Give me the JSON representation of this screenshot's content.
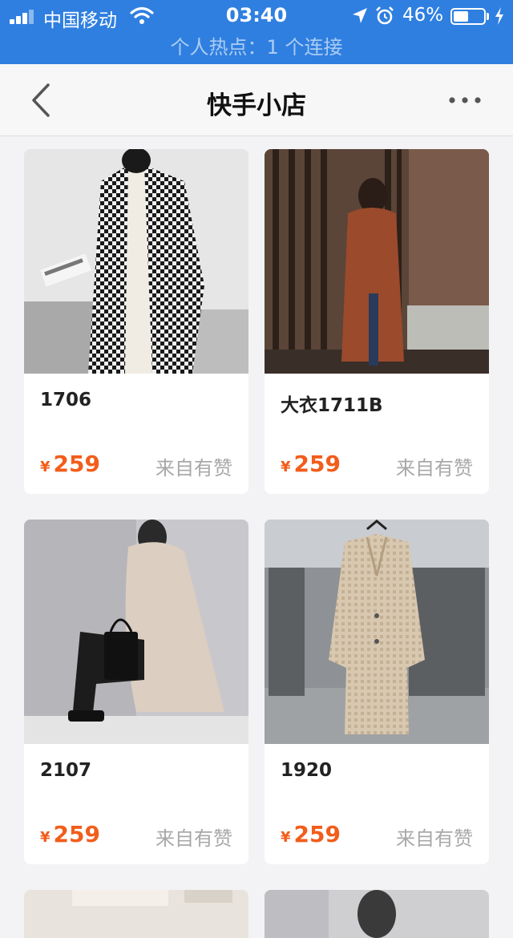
{
  "status_bar": {
    "carrier": "中国移动",
    "time": "03:40",
    "battery_percent": "46%",
    "hotspot": "个人热点：1 个连接",
    "battery_level": 0.46
  },
  "nav": {
    "title": "快手小店",
    "back_icon": "chevron-left-icon",
    "more_icon": "more-dots-icon"
  },
  "products": [
    {
      "name": "1706",
      "currency": "¥",
      "price": "259",
      "source": "来自有赞"
    },
    {
      "name": "大衣1711B",
      "currency": "¥",
      "price": "259",
      "source": "来自有赞"
    },
    {
      "name": "2107",
      "currency": "¥",
      "price": "259",
      "source": "来自有赞"
    },
    {
      "name": "1920",
      "currency": "¥",
      "price": "259",
      "source": "来自有赞"
    }
  ],
  "colors": {
    "status_bar": "#2f7fe0",
    "price": "#f25d1b",
    "source_text": "#a8a8a8",
    "background": "#f3f3f5"
  }
}
